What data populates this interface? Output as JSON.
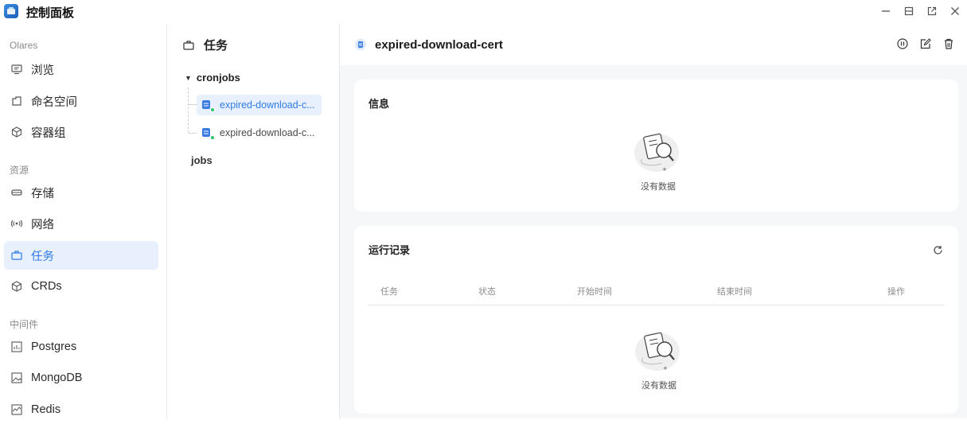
{
  "app": {
    "title": "控制面板"
  },
  "sidebar": {
    "sections": [
      {
        "label": "Olares"
      },
      {
        "label": "资源"
      },
      {
        "label": "中间件"
      }
    ],
    "items": [
      {
        "label": "浏览",
        "icon": "browse-icon"
      },
      {
        "label": "命名空间",
        "icon": "namespace-icon"
      },
      {
        "label": "容器组",
        "icon": "cube-icon"
      },
      {
        "label": "存储",
        "icon": "storage-icon"
      },
      {
        "label": "网络",
        "icon": "network-icon"
      },
      {
        "label": "任务",
        "icon": "briefcase-icon",
        "active": true
      },
      {
        "label": "CRDs",
        "icon": "cube-icon"
      },
      {
        "label": "Postgres",
        "icon": "chart-icon"
      },
      {
        "label": "MongoDB",
        "icon": "image-icon"
      },
      {
        "label": "Redis",
        "icon": "wave-icon"
      }
    ]
  },
  "tree": {
    "title": "任务",
    "group": "cronjobs",
    "items": [
      {
        "label": "expired-download-c...",
        "selected": true
      },
      {
        "label": "expired-download-c...",
        "selected": false
      }
    ],
    "jobs_label": "jobs"
  },
  "content": {
    "title": "expired-download-cert",
    "info_card": {
      "title": "信息",
      "empty_text": "没有数据"
    },
    "records_card": {
      "title": "运行记录",
      "columns": [
        "任务",
        "状态",
        "开始时间",
        "结束时间",
        "操作"
      ],
      "empty_text": "没有数据"
    }
  },
  "colors": {
    "accent": "#2f7be5",
    "active_bg": "#e8f0fd",
    "status_green": "#29c46a"
  }
}
